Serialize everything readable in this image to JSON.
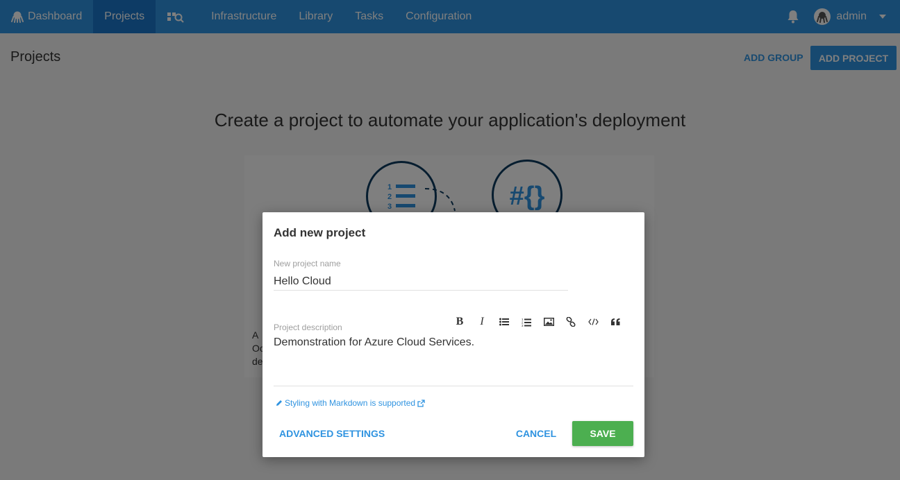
{
  "colors": {
    "primary": "#2f93e0",
    "nav_active": "#1a77ca",
    "save": "#4caf50",
    "icon_navy": "#0d3a5e"
  },
  "nav": {
    "items": [
      {
        "label": "Dashboard",
        "icon": "octopus-icon"
      },
      {
        "label": "Projects"
      },
      {
        "label": "",
        "icon": "search-projects-icon"
      },
      {
        "label": "Infrastructure"
      },
      {
        "label": "Library"
      },
      {
        "label": "Tasks"
      },
      {
        "label": "Configuration"
      }
    ],
    "user": {
      "name": "admin",
      "icon": "user-avatar-icon"
    }
  },
  "page": {
    "title": "Projects",
    "add_group": "ADD GROUP",
    "add_project": "ADD PROJECT",
    "hero_title": "Create a project to automate your application's deployment",
    "bg_text_lines": [
      "A",
      "Oc",
      "de"
    ]
  },
  "dialog": {
    "title": "Add new project",
    "name_label": "New project name",
    "name_value": "Hello Cloud",
    "description_label": "Project description",
    "description_value": "Demonstration for Azure Cloud Services.",
    "toolbar": [
      "bold-icon",
      "italic-icon",
      "bullet-list-icon",
      "numbered-list-icon",
      "image-icon",
      "link-icon",
      "code-icon",
      "quote-icon"
    ],
    "markdown_hint": "Styling with Markdown is supported",
    "advanced_settings": "ADVANCED SETTINGS",
    "cancel": "CANCEL",
    "save": "SAVE"
  }
}
